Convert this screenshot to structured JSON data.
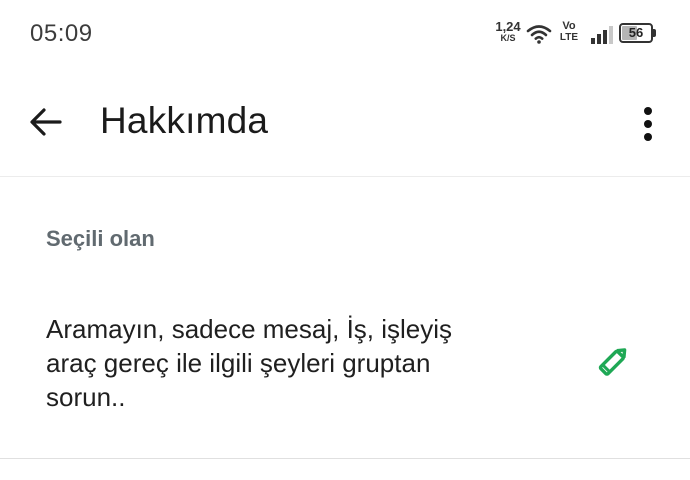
{
  "status_bar": {
    "time": "05:09",
    "net_speed_value": "1,24",
    "net_speed_unit": "K/S",
    "volte_top": "Vo",
    "volte_bottom": "LTE",
    "battery_level": "56",
    "battery_fraction": 0.56,
    "icons": [
      "wifi-icon",
      "signal-icon",
      "battery-icon"
    ]
  },
  "app_bar": {
    "title": "Hakkımda",
    "back_icon": "arrow-back-icon",
    "menu_icon": "more-vert-icon"
  },
  "content": {
    "section_header": "Seçili olan",
    "about_text": "Aramayın, sadece mesaj, İş, işleyiş\naraç gereç ile ilgili şeyleri gruptan\nsorun..",
    "edit_icon": "pencil-icon"
  },
  "colors": {
    "accent": "#1fa855",
    "text_primary": "#1f1f1f",
    "text_secondary": "#616a70",
    "divider": "#e0e0e0"
  }
}
